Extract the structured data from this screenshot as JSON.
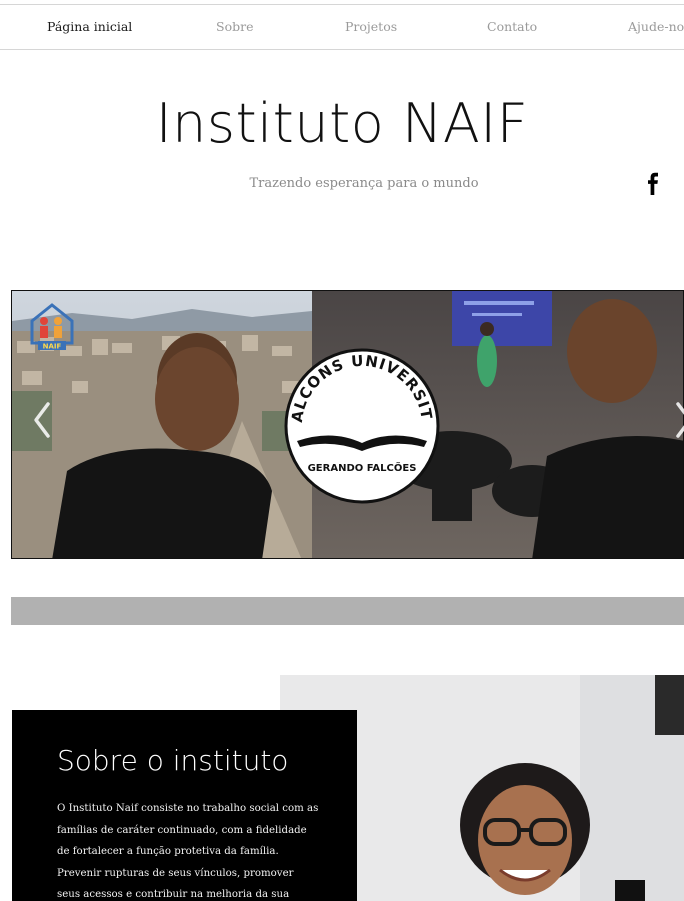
{
  "nav": {
    "items": [
      {
        "label": "Página inicial",
        "active": true
      },
      {
        "label": "Sobre",
        "active": false
      },
      {
        "label": "Projetos",
        "active": false
      },
      {
        "label": "Contato",
        "active": false
      },
      {
        "label": "Ajude-nos",
        "active": false
      }
    ]
  },
  "header": {
    "title": "Instituto NAIF",
    "tagline": "Trazendo esperança para o mundo",
    "social_icon": "facebook-icon"
  },
  "slideshow": {
    "logo_text": "NAIF",
    "badge_arc_text": "FALCONS UNIVERSITY",
    "badge_bottom_text": "GERANDO FALCÕES",
    "prev_icon": "chevron-left-icon",
    "next_icon": "chevron-right-icon"
  },
  "about": {
    "title": "Sobre o instituto",
    "text": "O Instituto Naif consiste no trabalho social com as famílias de caráter continuado, com a fidelidade de fortalecer a função protetiva da família. Prevenir rupturas de seus vínculos, promover seus acessos e contribuir na melhoria da sua qualidade de vida! Promover o"
  },
  "colors": {
    "nav_active": "#1a1a1a",
    "nav_inactive": "#9a9a9a",
    "band_gray": "#b1b1b1",
    "about_bg": "#000000"
  }
}
